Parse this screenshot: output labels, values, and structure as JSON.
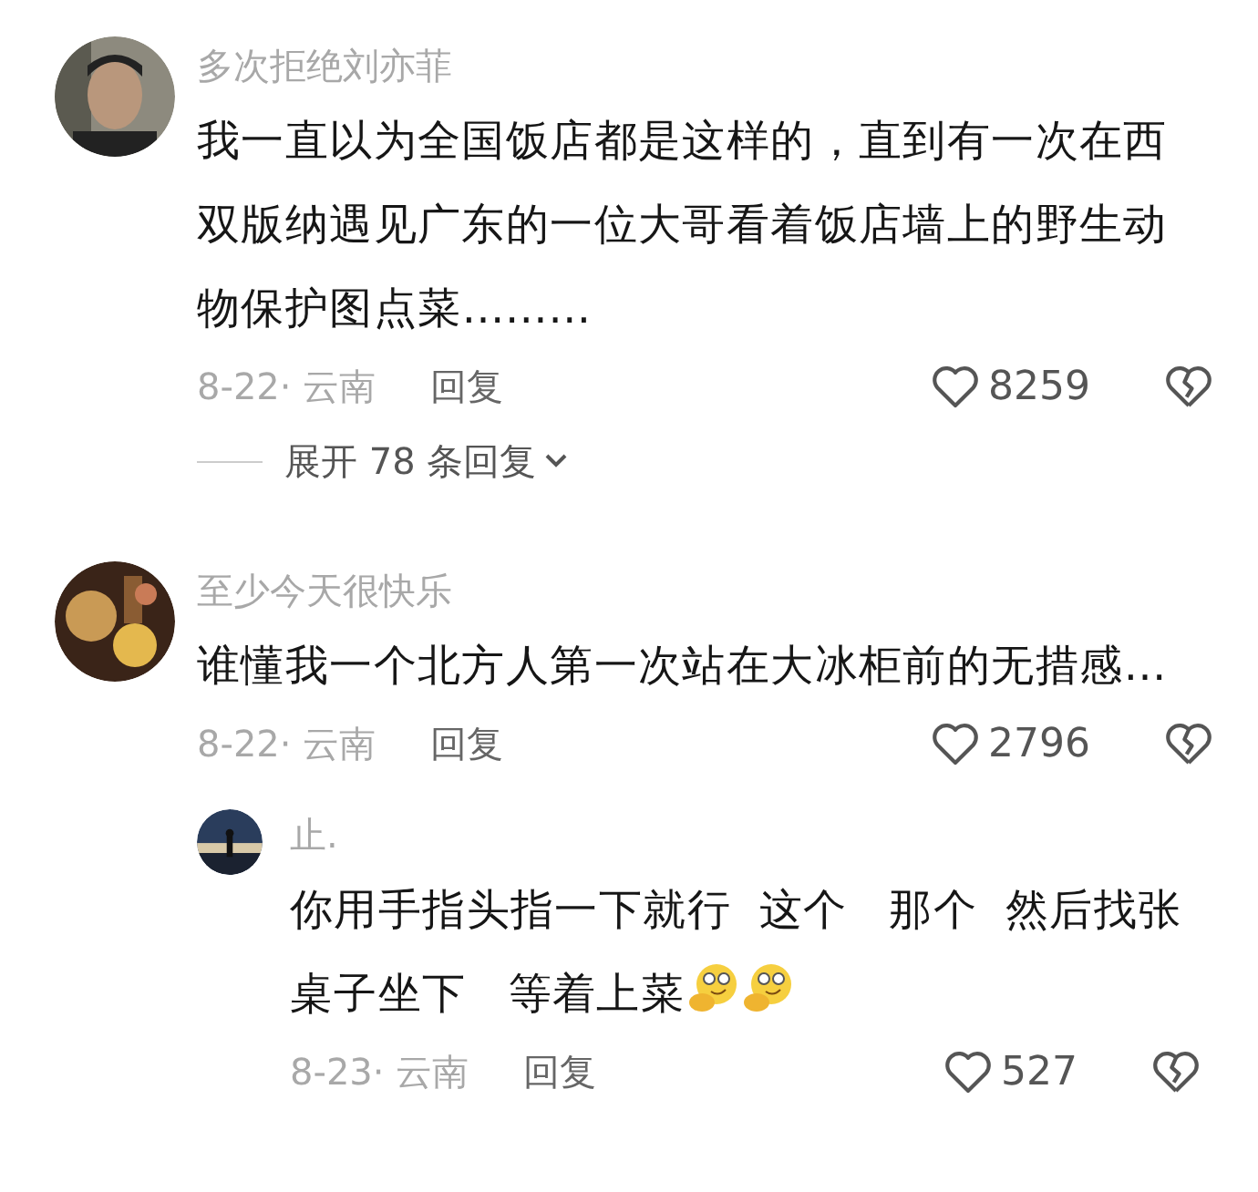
{
  "comments": [
    {
      "author": "多次拒绝刘亦菲",
      "avatar": {
        "kind": "picture"
      },
      "text": "我一直以为全国饭店都是这样的，直到有一次在西双版纳遇见广东的一位大哥看着饭店墙上的野生动物保护图点菜………",
      "date": "8-22· 云南",
      "reply_label": "回复",
      "likes": "8259",
      "expand": "展开 78 条回复"
    },
    {
      "author": "至少今天很快乐",
      "avatar": {
        "kind": "picture"
      },
      "text": "谁懂我一个北方人第一次站在大冰柜前的无措感…",
      "date": "8-22· 云南",
      "reply_label": "回复",
      "likes": "2796",
      "replies": [
        {
          "author": "止.",
          "avatar": {
            "kind": "picture"
          },
          "text": "你用手指头指一下就行  这个   那个  然后找张桌子坐下   等着上菜",
          "trailing_icons": [
            {
              "kind": "emoji"
            },
            {
              "kind": "emoji"
            }
          ],
          "date": "8-23· 云南",
          "reply_label": "回复",
          "likes": "527"
        }
      ]
    }
  ]
}
